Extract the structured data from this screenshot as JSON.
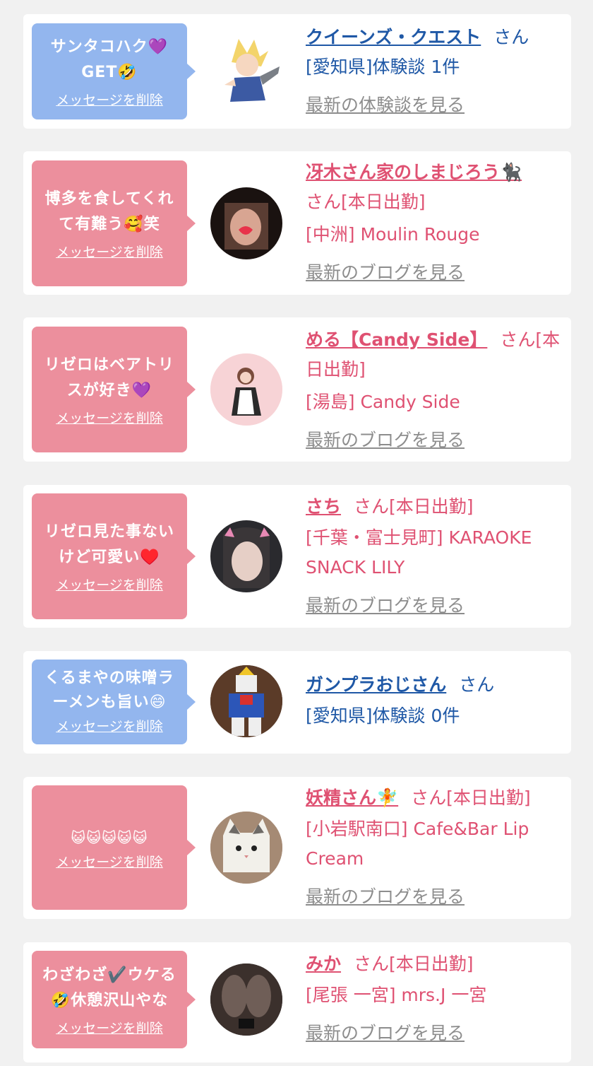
{
  "delete_label": "メッセージを削除",
  "colors": {
    "blue_bubble": "#93b6ee",
    "pink_bubble": "#ec8f9d",
    "blue_text": "#1f58a6",
    "pink_text": "#df5172",
    "link_gray": "#8d8d8d"
  },
  "items": [
    {
      "message_line1": "サンタコハク💜",
      "message_line2": "GET🤣",
      "name": "クイーンズ・クエスト",
      "suffix": "さん",
      "detail": "[愛知県]体験談 1件",
      "detail2": "",
      "link": "最新の体験談を見る",
      "avatar_icon": "anime-character-icon"
    },
    {
      "message_line1": "博多を食してくれ",
      "message_line2": "て有難う🥰笑",
      "name": "冴木さん家のしまじろう🐈‍⬛",
      "suffix": "さん[本日出勤]",
      "detail": "[中洲] Moulin Rouge",
      "detail2": "",
      "link": "最新のブログを見る",
      "avatar_icon": "woman-photo-icon"
    },
    {
      "message_line1": "リゼロはベアトリ",
      "message_line2": "スが好き💜",
      "name": "める【Candy Side】",
      "suffix": "さん[本",
      "suffix2": "日出勤]",
      "detail": "[湯島] Candy Side",
      "detail2": "",
      "link": "最新のブログを見る",
      "avatar_icon": "maid-photo-icon"
    },
    {
      "message_line1": "リゼロ見た事ない",
      "message_line2": "けど可愛い♥️",
      "name": "さち",
      "suffix": "さん[本日出勤]",
      "detail": "[千葉・富士見町] KARAOKE",
      "detail2": "SNACK LILY",
      "link": "最新のブログを見る",
      "avatar_icon": "woman-photo-icon"
    },
    {
      "message_line1": "くるまやの味噌ラ",
      "message_line2": "ーメンも旨い😄",
      "name": "ガンプラおじさん",
      "suffix": "さん",
      "detail": "[愛知県]体験談 0件",
      "detail2": "",
      "link": "",
      "avatar_icon": "robot-model-icon"
    },
    {
      "message_line1": "😺😺😺😺😺",
      "message_line2": "",
      "name": "妖精さん🧚",
      "suffix": "さん[本日出勤]",
      "detail": "[小岩駅南口] Cafe&Bar Lip",
      "detail2": "Cream",
      "link": "最新のブログを見る",
      "avatar_icon": "cat-photo-icon"
    },
    {
      "message_line1": "わざわざ✔️ウケる",
      "message_line2": "🤣休憩沢山やな",
      "name": "みか",
      "suffix": "さん[本日出勤]",
      "detail": "[尾張 一宮] mrs.J 一宮",
      "detail2": "",
      "link": "最新のブログを見る",
      "avatar_icon": "legs-photo-icon"
    }
  ]
}
